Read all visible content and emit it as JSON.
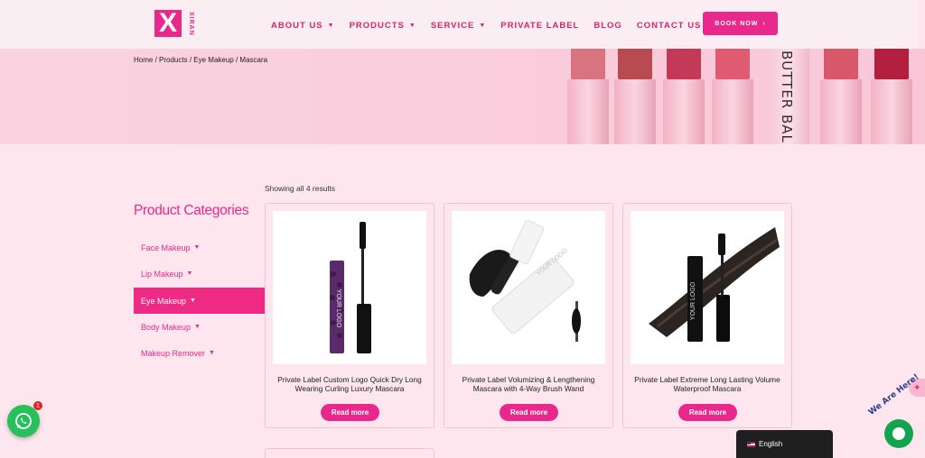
{
  "brand": {
    "logo_letter": "X",
    "logo_word": "XIRAN",
    "accent": "#e8288a"
  },
  "nav": {
    "items": [
      {
        "label": "ABOUT US",
        "dropdown": true
      },
      {
        "label": "PRODUCTS",
        "dropdown": true
      },
      {
        "label": "SERVICE",
        "dropdown": true
      },
      {
        "label": "PRIVATE LABEL",
        "dropdown": false
      },
      {
        "label": "BLOG",
        "dropdown": false
      },
      {
        "label": "CONTACT US",
        "dropdown": false
      }
    ],
    "book_label": "BOOK NOW",
    "book_icon": "chevron-right-icon"
  },
  "breadcrumb": [
    "Home",
    "Products",
    "Eye Makeup",
    "Mascara"
  ],
  "hero": {
    "lipstick_text": "BUTTER BAL"
  },
  "sidebar": {
    "title": "Product Categories",
    "items": [
      {
        "label": "Face Makeup",
        "active": false
      },
      {
        "label": "Lip Makeup",
        "active": false
      },
      {
        "label": "Eye Makeup",
        "active": true
      },
      {
        "label": "Body Makeup",
        "active": false
      },
      {
        "label": "Makeup Remover",
        "active": false
      }
    ]
  },
  "results_text": "Showing all 4 results",
  "products": [
    {
      "name": "Private Label Custom Logo Quick Dry Long Wearing Curling Luxury Mascara",
      "button": "Read more",
      "image_text": "YOUR LOGO"
    },
    {
      "name": "Private Label Volumizing & Lengthening Mascara with 4-Way Brush Wand",
      "button": "Read more",
      "image_text": "YOUR LOGO"
    },
    {
      "name": "Private Label Extreme Long Lasting Volume Waterproof Mascara",
      "button": "Read more",
      "image_text": "YOUR LOGO"
    }
  ],
  "whatsapp": {
    "badge": "1",
    "icon": "whatsapp-icon"
  },
  "language": {
    "label": "English",
    "flag": "us-flag-icon"
  },
  "chat_widget": {
    "label": "We Are Here!",
    "icon": "chat-icon"
  }
}
